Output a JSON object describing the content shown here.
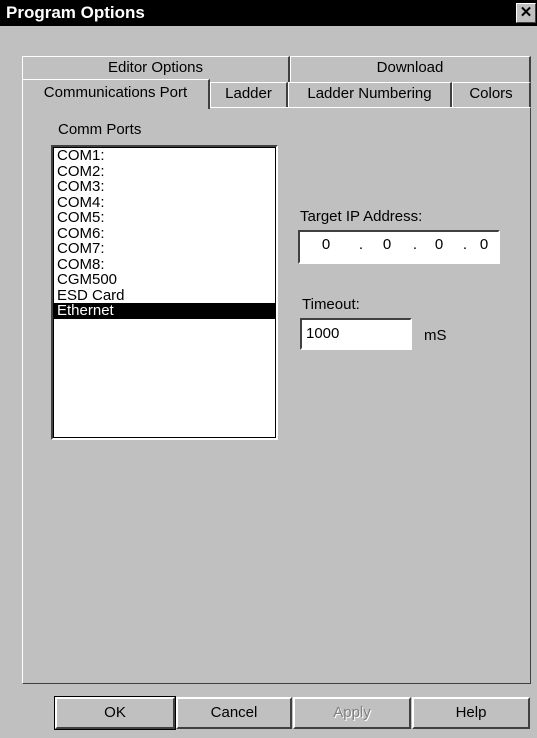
{
  "window": {
    "title": "Program Options"
  },
  "tabs": {
    "back_row": [
      "Editor Options",
      "Download"
    ],
    "front_row": [
      "Communications Port",
      "Ladder",
      "Ladder Numbering",
      "Colors"
    ],
    "active": "Communications Port"
  },
  "comm_ports": {
    "label": "Comm Ports",
    "items": [
      "COM1:",
      "COM2:",
      "COM3:",
      "COM4:",
      "COM5:",
      "COM6:",
      "COM7:",
      "COM8:",
      "CGM500",
      "ESD Card",
      "Ethernet"
    ],
    "selected": "Ethernet"
  },
  "target_ip": {
    "label": "Target IP Address:",
    "octets": [
      "0",
      "0",
      "0",
      "0"
    ],
    "separator": "."
  },
  "timeout": {
    "label": "Timeout:",
    "value": "1000",
    "unit": "mS"
  },
  "buttons": {
    "ok": "OK",
    "cancel": "Cancel",
    "apply": "Apply",
    "help": "Help"
  },
  "icons": {
    "close": "close-icon"
  }
}
